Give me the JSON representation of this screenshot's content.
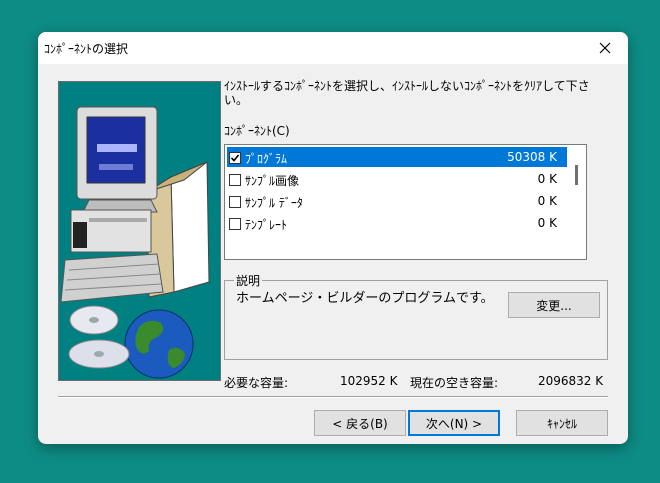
{
  "window": {
    "title": "ｺﾝﾎﾟｰﾈﾝﾄの選択"
  },
  "instruction": "ｲﾝｽﾄｰﾙするｺﾝﾎﾟｰﾈﾝﾄを選択し、ｲﾝｽﾄｰﾙしないｺﾝﾎﾟｰﾈﾝﾄをｸﾘｱして下さい。",
  "components": {
    "label": "ｺﾝﾎﾟｰﾈﾝﾄ(C)",
    "items": [
      {
        "name": "ﾌﾟﾛｸﾞﾗﾑ",
        "size": "50308 K",
        "checked": true,
        "selected": true
      },
      {
        "name": "ｻﾝﾌﾟﾙ画像",
        "size": "0 K",
        "checked": false,
        "selected": false
      },
      {
        "name": "ｻﾝﾌﾟﾙ ﾃﾞｰﾀ",
        "size": "0 K",
        "checked": false,
        "selected": false
      },
      {
        "name": "ﾃﾝﾌﾟﾚｰﾄ",
        "size": "0 K",
        "checked": false,
        "selected": false
      }
    ]
  },
  "description": {
    "label": "説明",
    "text": "ホームページ・ビルダーのプログラムです。",
    "change_button": "変更..."
  },
  "space": {
    "required_label": "必要な容量:",
    "required_value": "102952 K",
    "free_label": "現在の空き容量:",
    "free_value": "2096832 K"
  },
  "buttons": {
    "back": "< 戻る(B)",
    "next": "次へ(N) >",
    "cancel": "ｷｬﾝｾﾙ"
  },
  "colors": {
    "desktop": "#0d8c85",
    "selection": "#0078d7",
    "picture_bg": "#008080"
  }
}
